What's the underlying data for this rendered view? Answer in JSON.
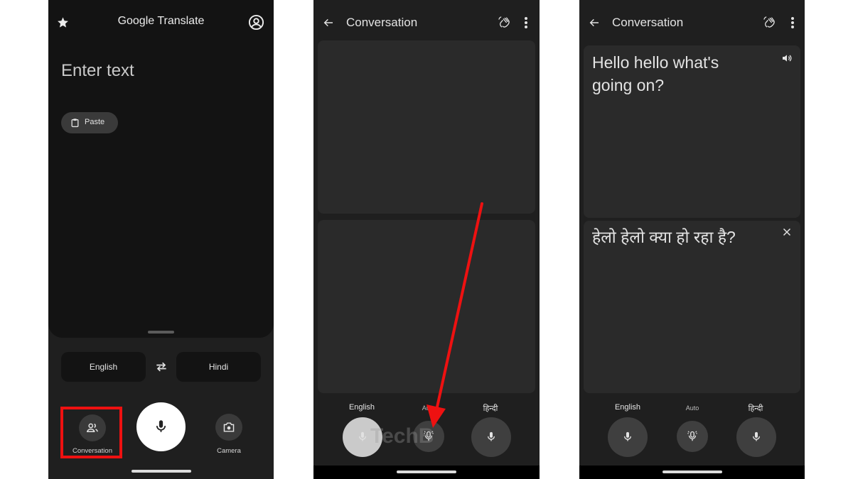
{
  "screen1": {
    "app_title": "Google Translate",
    "input_placeholder": "Enter text",
    "paste_label": "Paste",
    "source_language": "English",
    "target_language": "Hindi",
    "conversation_label": "Conversation",
    "camera_label": "Camera",
    "icons": [
      "star-icon",
      "account-icon",
      "clipboard-icon",
      "swap-icon",
      "people-icon",
      "mic-icon",
      "camera-icon"
    ]
  },
  "screen2": {
    "title": "Conversation",
    "label_left": "English",
    "label_mid": "Auto",
    "label_right": "हिन्दी",
    "watermark": "TechB",
    "icons": [
      "back-arrow-icon",
      "wave-hand-icon",
      "more-vert-icon",
      "mic-icon",
      "auto-mic-icon"
    ]
  },
  "screen3": {
    "title": "Conversation",
    "source_text": "Hello hello what's going on?",
    "translated_text": "हेलो हेलो क्या हो रहा है?",
    "label_left": "English",
    "label_mid": "Auto",
    "label_right": "हिन्दी",
    "icons": [
      "back-arrow-icon",
      "wave-hand-icon",
      "more-vert-icon",
      "speaker-icon",
      "close-icon",
      "mic-icon"
    ]
  },
  "colors": {
    "highlight_box": "#ee1111",
    "arrow": "#ee1111",
    "screen_background": "#1f1f1f",
    "panel_background": "#2a2a2a"
  }
}
